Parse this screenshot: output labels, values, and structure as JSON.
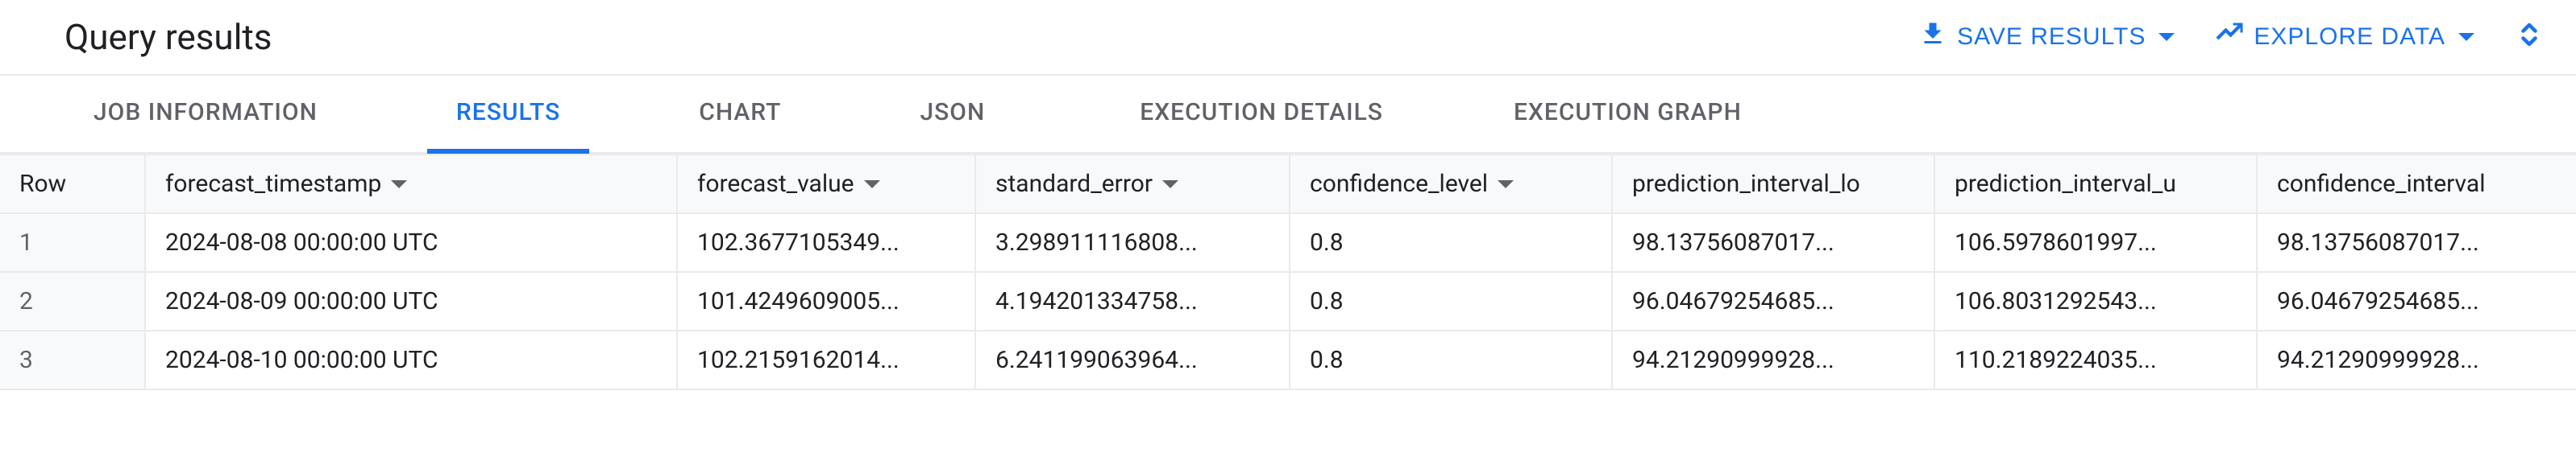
{
  "header": {
    "title": "Query results",
    "save_results": "SAVE RESULTS",
    "explore_data": "EXPLORE DATA"
  },
  "tabs": {
    "job_information": "JOB INFORMATION",
    "results": "RESULTS",
    "chart": "CHART",
    "json": "JSON",
    "execution_details": "EXECUTION DETAILS",
    "execution_graph": "EXECUTION GRAPH"
  },
  "columns": {
    "row": "Row",
    "forecast_timestamp": "forecast_timestamp",
    "forecast_value": "forecast_value",
    "standard_error": "standard_error",
    "confidence_level": "confidence_level",
    "prediction_interval_lower": "prediction_interval_lo",
    "prediction_interval_upper": "prediction_interval_u",
    "confidence_interval": "confidence_interval"
  },
  "rows": [
    {
      "n": "1",
      "ts": "2024-08-08 00:00:00 UTC",
      "fv": "102.3677105349...",
      "se": "3.298911116808...",
      "cl": "0.8",
      "pil": "98.13756087017...",
      "piu": "106.5978601997...",
      "ci": "98.13756087017..."
    },
    {
      "n": "2",
      "ts": "2024-08-09 00:00:00 UTC",
      "fv": "101.4249609005...",
      "se": "4.194201334758...",
      "cl": "0.8",
      "pil": "96.04679254685...",
      "piu": "106.8031292543...",
      "ci": "96.04679254685..."
    },
    {
      "n": "3",
      "ts": "2024-08-10 00:00:00 UTC",
      "fv": "102.2159162014...",
      "se": "6.241199063964...",
      "cl": "0.8",
      "pil": "94.21290999928...",
      "piu": "110.2189224035...",
      "ci": "94.21290999928..."
    }
  ]
}
